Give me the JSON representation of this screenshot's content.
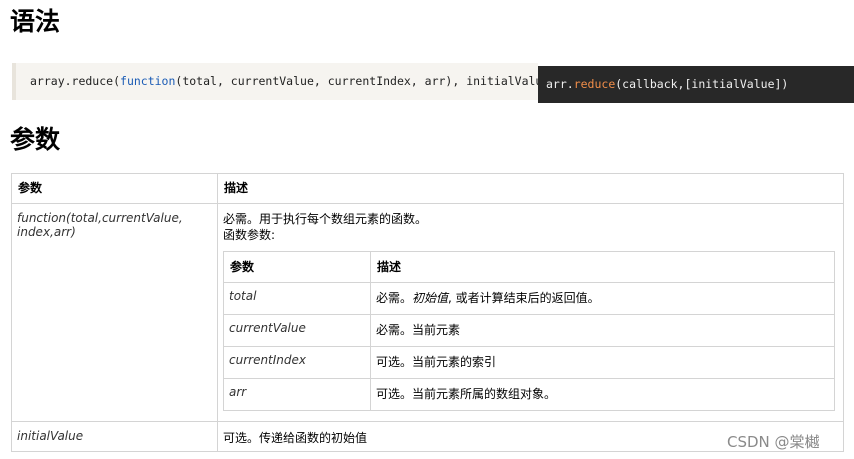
{
  "headings": {
    "syntax": "语法",
    "params": "参数"
  },
  "code": {
    "pre_fn": "array.reduce(",
    "fn_keyword": "function",
    "post_fn": "(total, currentValue, currentIndex, arr), initialValue)"
  },
  "code_dark": {
    "pre": "arr.",
    "fn": "reduce",
    "post": "(callback,[initialValue])"
  },
  "outer_table": {
    "headers": [
      "参数",
      "描述"
    ],
    "row1": {
      "param": "function(total,currentValue, index,arr)",
      "desc_line1": "必需。用于执行每个数组元素的函数。",
      "desc_line2": "函数参数:"
    },
    "row2": {
      "param": "initialValue",
      "desc": "可选。传递给函数的初始值"
    }
  },
  "inner_table": {
    "headers": [
      "参数",
      "描述"
    ],
    "rows": [
      {
        "param": "total",
        "desc_pre": "必需。",
        "desc_ital": "初始值",
        "desc_post": ", 或者计算结束后的返回值。"
      },
      {
        "param": "currentValue",
        "desc_pre": "必需。当前元素",
        "desc_ital": "",
        "desc_post": ""
      },
      {
        "param": "currentIndex",
        "desc_pre": "可选。当前元素的索引",
        "desc_ital": "",
        "desc_post": ""
      },
      {
        "param": "arr",
        "desc_pre": "可选。当前元素所属的数组对象。",
        "desc_ital": "",
        "desc_post": ""
      }
    ]
  },
  "watermark": "CSDN @棠樾"
}
